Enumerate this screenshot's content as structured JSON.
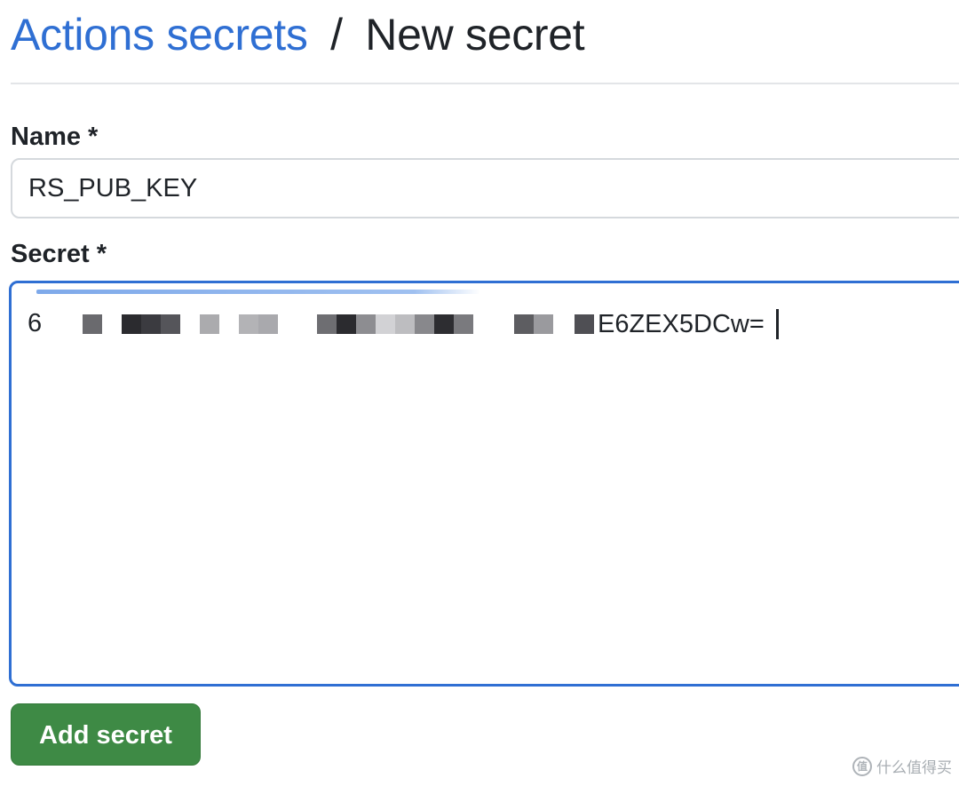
{
  "breadcrumb": {
    "parent_label": "Actions secrets",
    "separator": "/",
    "current_label": "New secret"
  },
  "form": {
    "name_label": "Name *",
    "name_value": "RS_PUB_KEY",
    "secret_label": "Secret *",
    "secret_visible_start": "6",
    "secret_visible_end": "E6ZEX5DCw=",
    "submit_label": "Add secret"
  },
  "watermark": {
    "logo_glyph": "值",
    "text": "什么值得买"
  },
  "colors": {
    "link": "#2f6fd3",
    "focus_border": "#2f6fd3",
    "button_bg": "#3e8a45",
    "text": "#1f2328"
  }
}
